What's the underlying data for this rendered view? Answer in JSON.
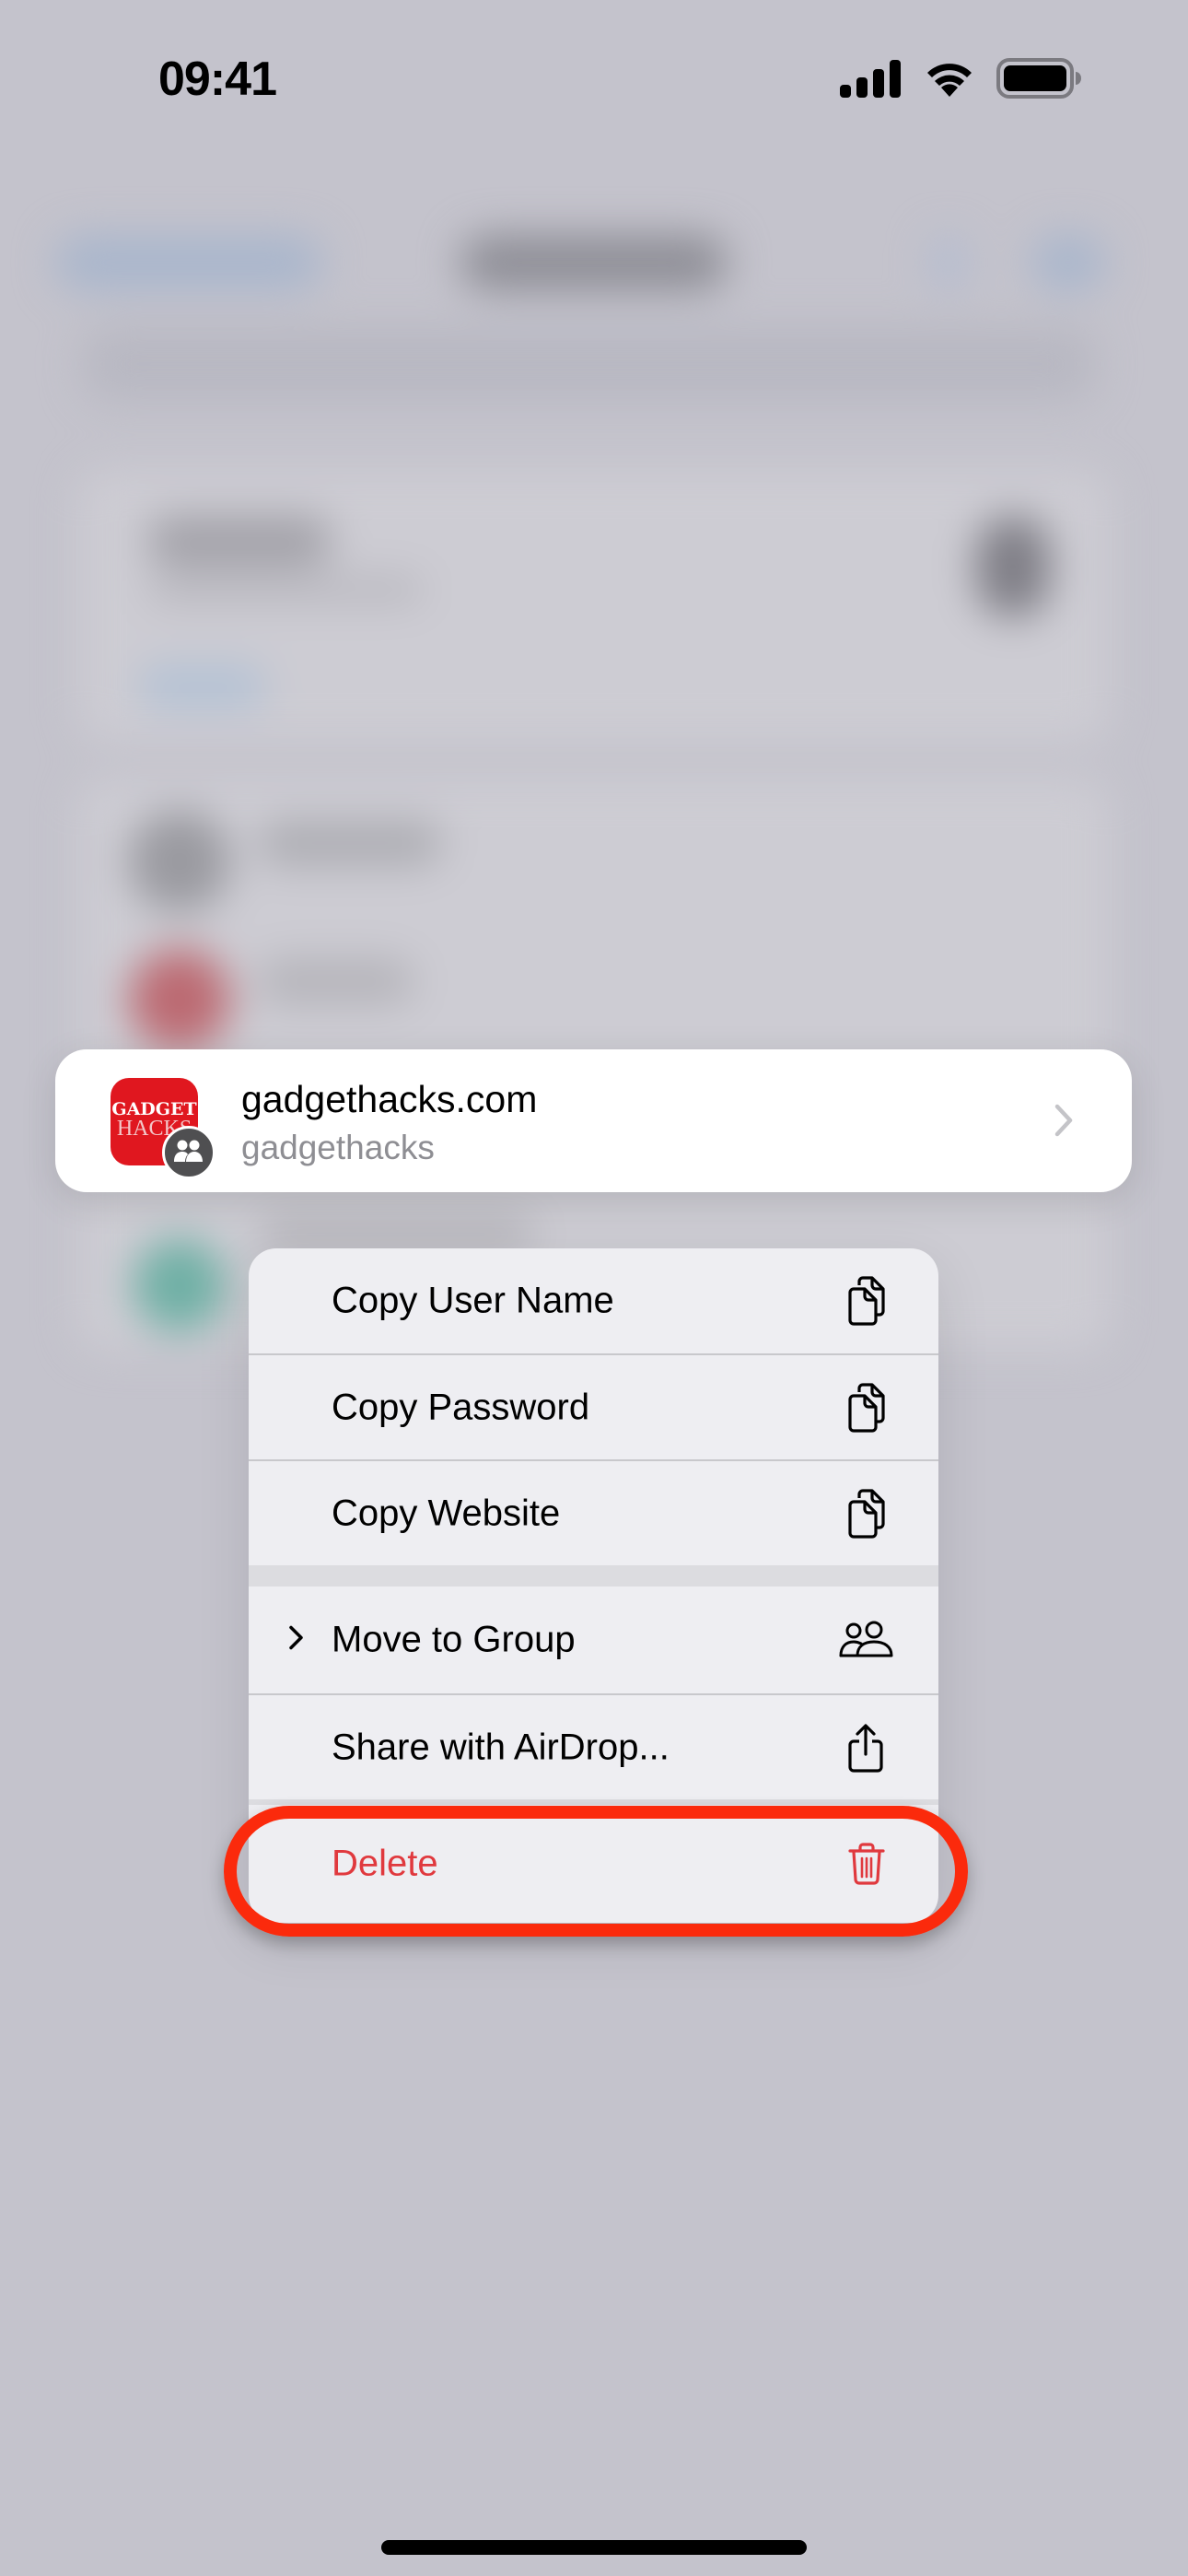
{
  "status_bar": {
    "time": "09:41",
    "icons": [
      "cellular-signal-icon",
      "wifi-icon",
      "battery-icon"
    ]
  },
  "selected_entry": {
    "title": "gadgethacks.com",
    "username": "gadgethacks",
    "app_icon": {
      "line1": "GADGET",
      "line2": "HACKS",
      "color": "#e0171f"
    },
    "shared_badge_icon": "people-icon",
    "disclosure_icon": "chevron-right-icon"
  },
  "context_menu": {
    "items": [
      {
        "label": "Copy User Name",
        "icon": "copy-icon"
      },
      {
        "label": "Copy Password",
        "icon": "copy-icon"
      },
      {
        "label": "Copy Website",
        "icon": "copy-icon"
      },
      {
        "label": "Move to Group",
        "icon": "people-icon",
        "submenu": true
      },
      {
        "label": "Share with AirDrop...",
        "icon": "share-icon"
      },
      {
        "label": "Delete",
        "icon": "trash-icon",
        "destructive": true
      }
    ],
    "destructive_color": "#e0393e"
  },
  "annotation": {
    "highlight_target": "Delete",
    "color": "#fb2a0c"
  }
}
